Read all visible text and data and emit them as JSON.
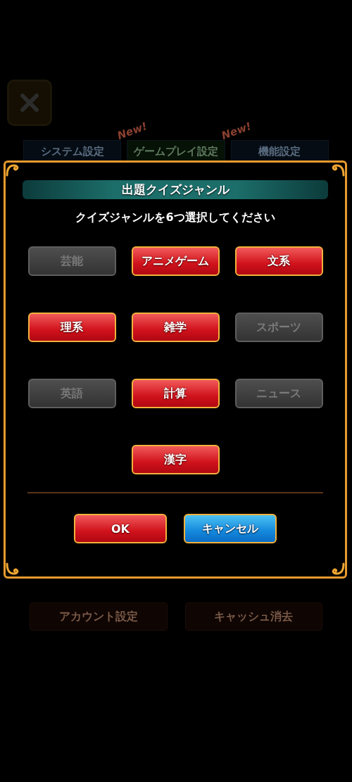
{
  "background": {
    "tabs": [
      {
        "label": "システム設定",
        "selected": false
      },
      {
        "label": "ゲームプレイ設定",
        "selected": true,
        "badge": "New!"
      },
      {
        "label": "機能設定",
        "selected": false,
        "badge": "New!"
      }
    ],
    "buttons": [
      "アカウント設定",
      "キャッシュ消去"
    ]
  },
  "dialog": {
    "title": "出題クイズジャンル",
    "instruction": "クイズジャンルを6つ選択してください",
    "genres": [
      {
        "label": "芸能",
        "selected": false
      },
      {
        "label": "アニメゲーム",
        "selected": true
      },
      {
        "label": "文系",
        "selected": true
      },
      {
        "label": "理系",
        "selected": true
      },
      {
        "label": "雑学",
        "selected": true
      },
      {
        "label": "スポーツ",
        "selected": false
      },
      {
        "label": "英語",
        "selected": false
      },
      {
        "label": "計算",
        "selected": true
      },
      {
        "label": "ニュース",
        "selected": false
      },
      {
        "label": "漢字",
        "selected": true
      }
    ],
    "buttons": [
      {
        "label": "OK",
        "kind": "confirm"
      },
      {
        "label": "キャンセル",
        "kind": "cancel"
      }
    ]
  }
}
